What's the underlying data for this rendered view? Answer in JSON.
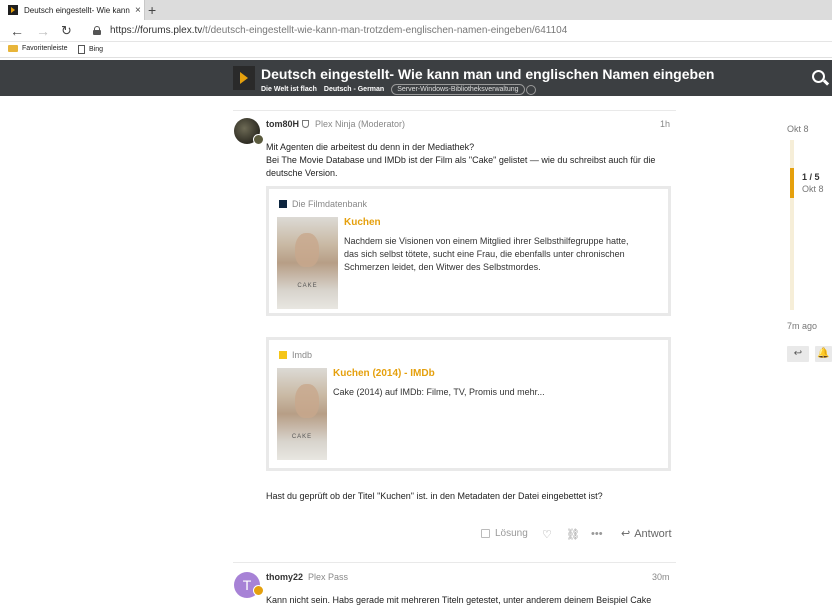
{
  "browser": {
    "tab_title": "Deutsch eingestellt- Wie kann m",
    "tab_close": "×",
    "new_tab": "+",
    "url_host": "https://forums.plex.tv",
    "url_path": "/t/deutsch-eingestellt-wie-kann-man-trotzdem-englischen-namen-eingeben/641104",
    "favorites": [
      "Favoritenleiste",
      "Bing"
    ]
  },
  "header": {
    "title": "Deutsch eingestellt- Wie kann man und englischen Namen eingeben",
    "breadcrumbs": [
      "Die Welt ist flach",
      "Deutsch - German"
    ],
    "tag": "Server-Windows-Bibliotheksverwaltung"
  },
  "post1": {
    "username": "tom80H",
    "user_title": "Plex Ninja (Moderator)",
    "time": "1h",
    "para1_line1": "Mit Agenten die arbeitest du denn in der Mediathek?",
    "para1_line2": "Bei The Movie Database und IMDb ist der Film als \"Cake\" gelistet — wie du schreibst auch für die",
    "para1_line3": "deutsche Version.",
    "onebox1": {
      "source": "Die Filmdatenbank",
      "title": "Kuchen",
      "desc_line1": "Nachdem sie Visionen von einem Mitglied ihrer Selbsthilfegruppe hatte,",
      "desc_line2": "das sich selbst tötete, sucht eine Frau, die ebenfalls unter chronischen",
      "desc_line3": "Schmerzen leidet, den Witwer des Selbstmordes."
    },
    "onebox2": {
      "source": "Imdb",
      "title": "Kuchen (2014) - IMDb",
      "desc": "Cake (2014) auf IMDb: Filme, TV, Promis und mehr..."
    },
    "closing": "Hast du geprüft ob der Titel \"Kuchen\" ist. in den Metadaten der Datei eingebettet ist?",
    "actions": {
      "solution": "Lösung",
      "reply": "Antwort"
    }
  },
  "post2": {
    "avatar_letter": "T",
    "username": "thomy22",
    "user_title": "Plex Pass",
    "time": "30m",
    "text": "Kann nicht sein. Habs gerade mit mehreren Titeln getestet, unter anderem deinem Beispiel Cake"
  },
  "timeline": {
    "start_date": "Okt 8",
    "position": "1 / 5",
    "position_date": "Okt 8",
    "end_label": "7m ago"
  },
  "colors": {
    "accent": "#e5a00d",
    "header_bg": "#3c3f42",
    "avatar_purple": "#a782d6"
  }
}
